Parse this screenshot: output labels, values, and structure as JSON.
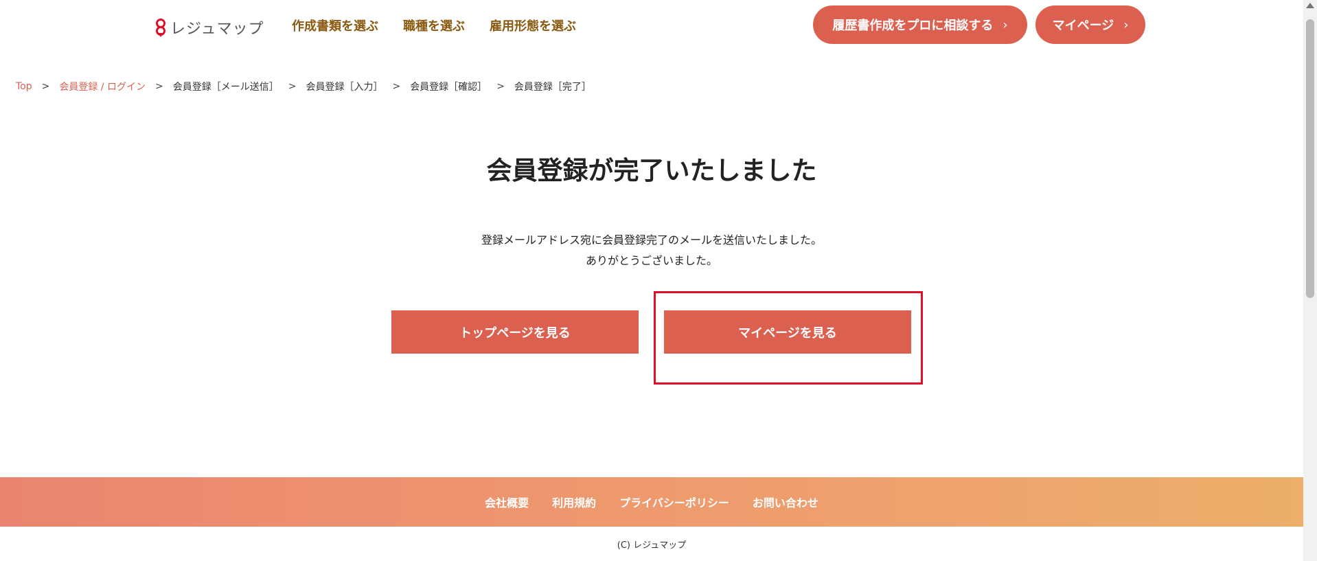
{
  "header": {
    "logo_text": "レジュマップ",
    "nav": [
      {
        "label": "作成書類を選ぶ"
      },
      {
        "label": "職種を選ぶ"
      },
      {
        "label": "雇用形態を選ぶ"
      }
    ],
    "consult_button": "履歴書作成をプロに相談する",
    "mypage_button": "マイページ",
    "chevron": "›"
  },
  "breadcrumb": {
    "items": [
      {
        "label": "Top"
      },
      {
        "label": "会員登録 / ログイン"
      },
      {
        "label": "会員登録［メール送信］"
      },
      {
        "label": "会員登録［入力］"
      },
      {
        "label": "会員登録［確認］"
      },
      {
        "label": "会員登録［完了］"
      }
    ],
    "separator": ">"
  },
  "main": {
    "title": "会員登録が完了いたしました",
    "message_line1": "登録メールアドレス宛に会員登録完了のメールを送信いたしました。",
    "message_line2": "ありがとうございました。",
    "top_button": "トップページを見る",
    "mypage_button": "マイページを見る"
  },
  "footer": {
    "links": [
      {
        "label": "会社概要"
      },
      {
        "label": "利用規約"
      },
      {
        "label": "プライバシーポリシー"
      },
      {
        "label": "お問い合わせ"
      }
    ],
    "copyright": "(C) レジュマップ"
  },
  "colors": {
    "accent": "#dc6050",
    "nav_text": "#8a5a12",
    "highlight_border": "#e0102a"
  }
}
